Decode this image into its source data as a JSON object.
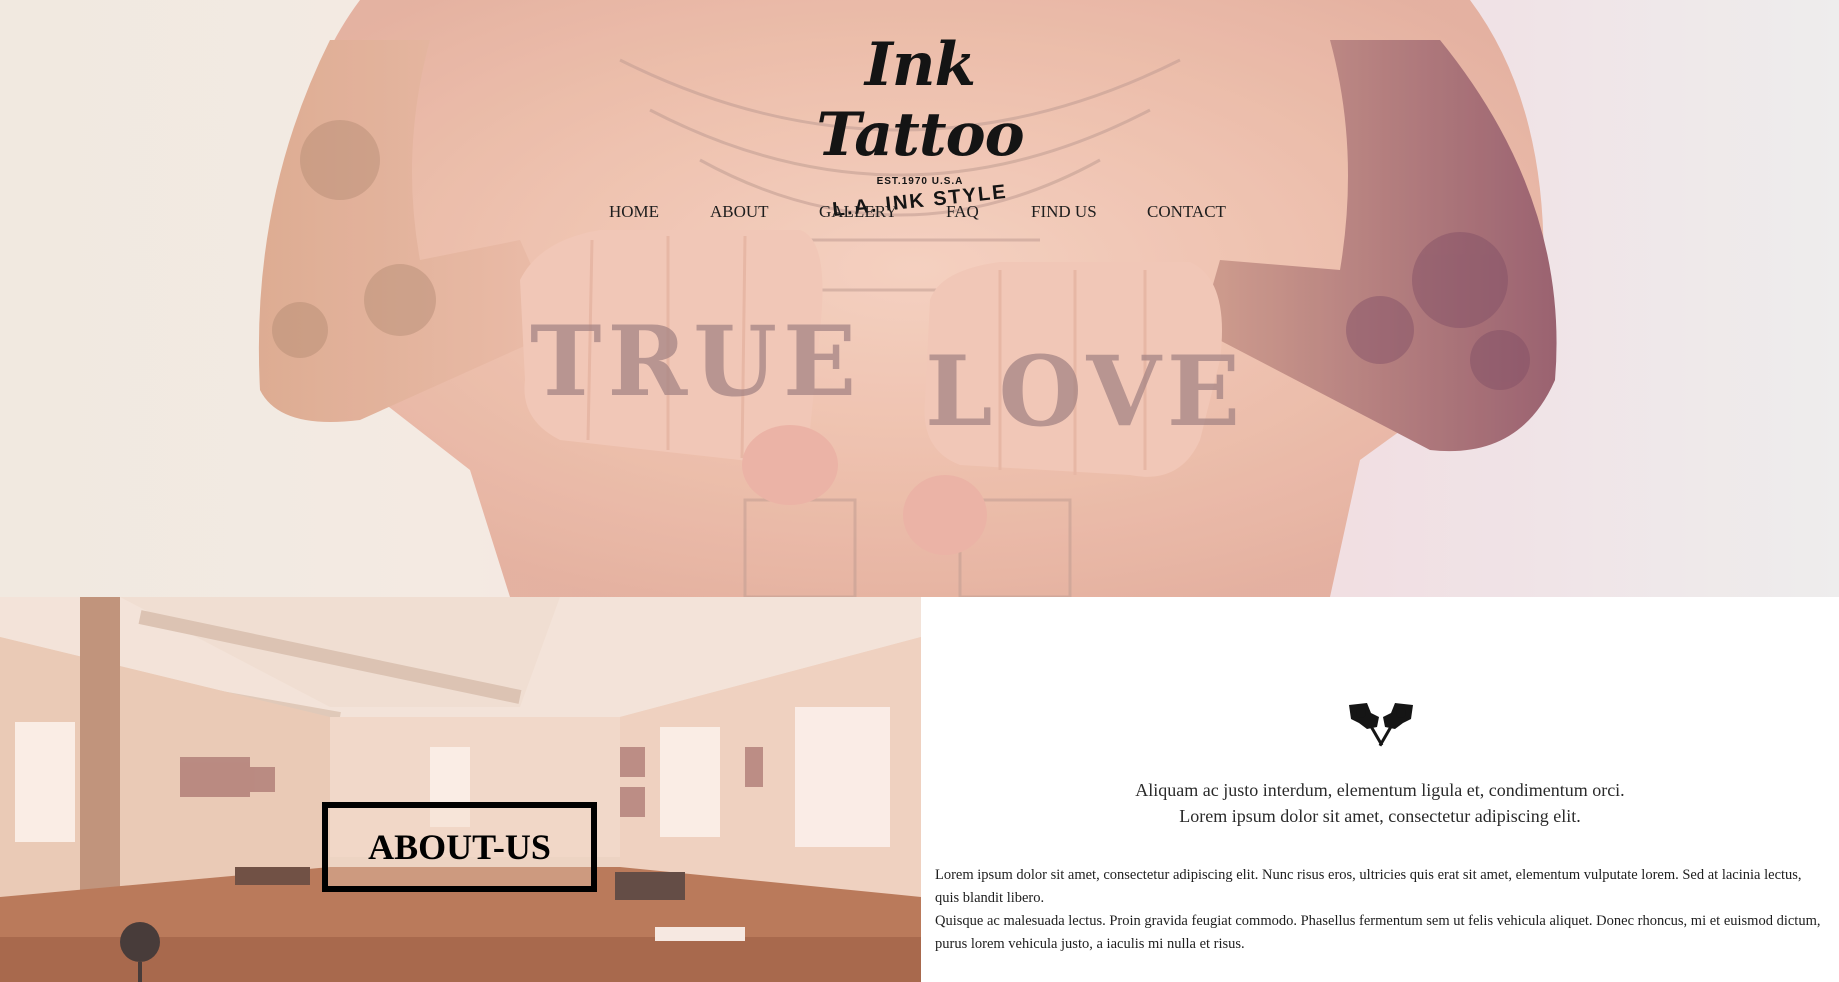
{
  "logo": {
    "script": "Ink Tattoo",
    "est": "EST.1970 U.S.A",
    "style": "L.A. INK STYLE"
  },
  "hero": {
    "knuckles_left": "TRUE",
    "knuckles_right": "LOVE"
  },
  "nav": {
    "items": [
      "HOME",
      "ABOUT",
      "GALLERY",
      "FAQ",
      "FIND US",
      "CONTACT"
    ]
  },
  "about": {
    "title": "ABOUT-US",
    "icon": "tattoo-machines-icon",
    "intro_line1": "Aliquam ac justo interdum, elementum ligula et, condimentum orci.",
    "intro_line2": "Lorem ipsum dolor sit amet, consectetur adipiscing elit.",
    "paragraph1": "Lorem ipsum dolor sit amet, consectetur adipiscing elit. Nunc risus eros, ultricies quis erat sit amet, elementum vulputate lorem. Sed at lacinia lectus, quis blandit libero.",
    "paragraph2": "Quisque ac malesuada lectus. Proin gravida feugiat commodo. Phasellus fermentum sem ut felis vehicula aliquet. Donec rhoncus, mi et euismod dictum, purus lorem vehicula justo, a iaculis mi nulla et risus."
  },
  "colors": {
    "text": "#1e1e1e",
    "background": "#ffffff",
    "box_border": "#000000"
  }
}
